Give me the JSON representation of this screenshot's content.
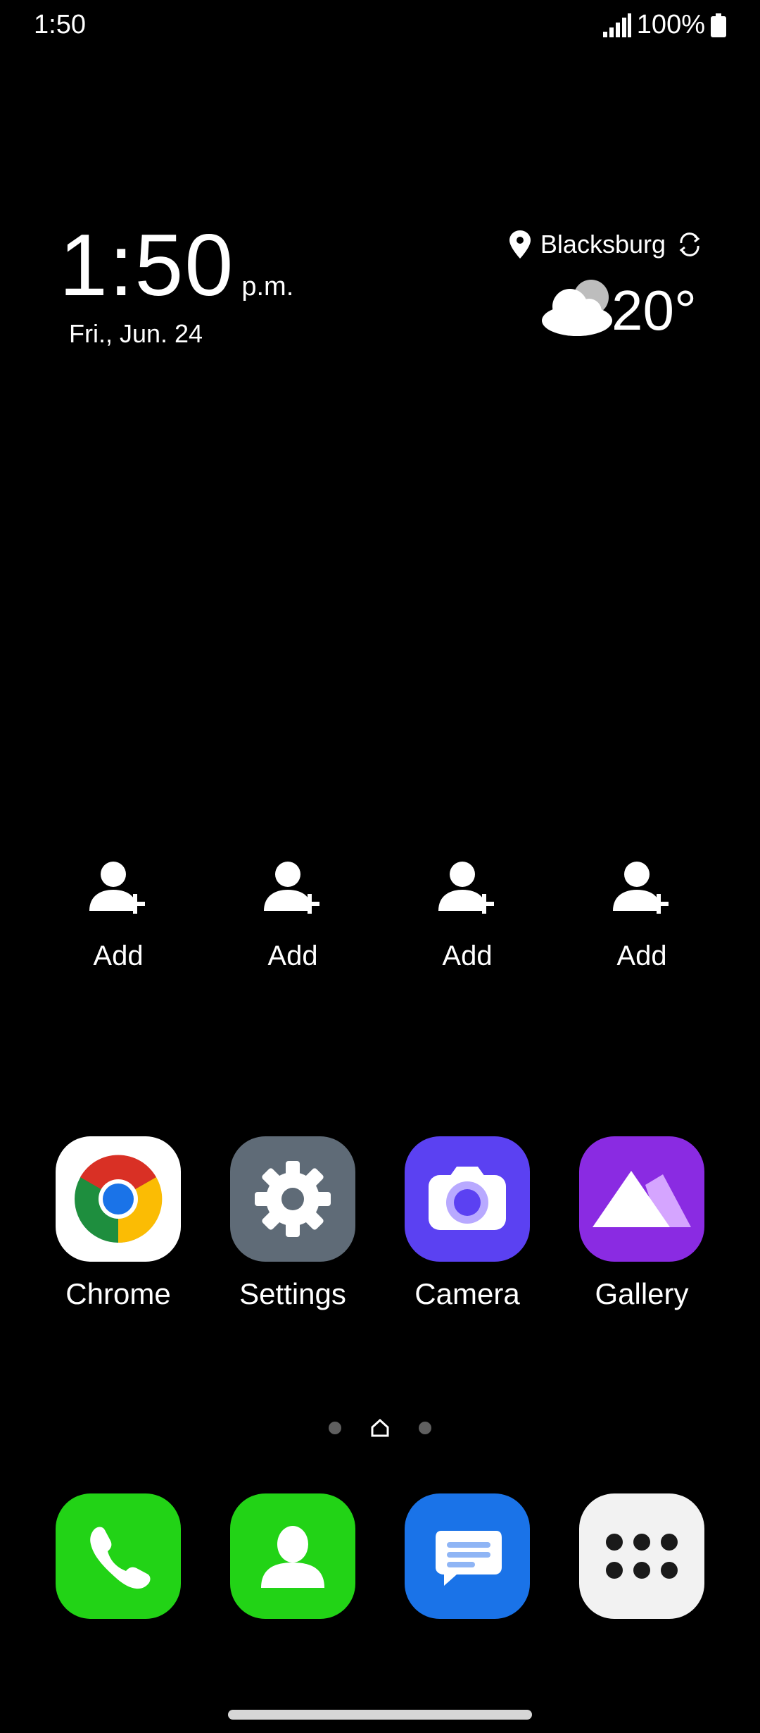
{
  "status_bar": {
    "time": "1:50",
    "battery": "100%"
  },
  "clock": {
    "time": "1:50",
    "ampm": "p.m.",
    "date": "Fri., Jun. 24"
  },
  "weather": {
    "location": "Blacksburg",
    "temperature": "20°"
  },
  "contacts": [
    {
      "label": "Add"
    },
    {
      "label": "Add"
    },
    {
      "label": "Add"
    },
    {
      "label": "Add"
    }
  ],
  "apps": [
    {
      "label": "Chrome",
      "icon": "chrome-icon"
    },
    {
      "label": "Settings",
      "icon": "gear-icon"
    },
    {
      "label": "Camera",
      "icon": "camera-icon"
    },
    {
      "label": "Gallery",
      "icon": "gallery-icon"
    }
  ],
  "dock": [
    {
      "icon": "phone-icon"
    },
    {
      "icon": "contacts-icon"
    },
    {
      "icon": "messages-icon"
    },
    {
      "icon": "app-drawer-icon"
    }
  ],
  "colors": {
    "background": "#000000",
    "phone": "#22d316",
    "contacts": "#22d316",
    "messages": "#1a73e8",
    "camera": "#5b41f2",
    "gallery": "#8a2be2",
    "settings": "#5f6b77",
    "drawer": "#f2f2f2"
  }
}
